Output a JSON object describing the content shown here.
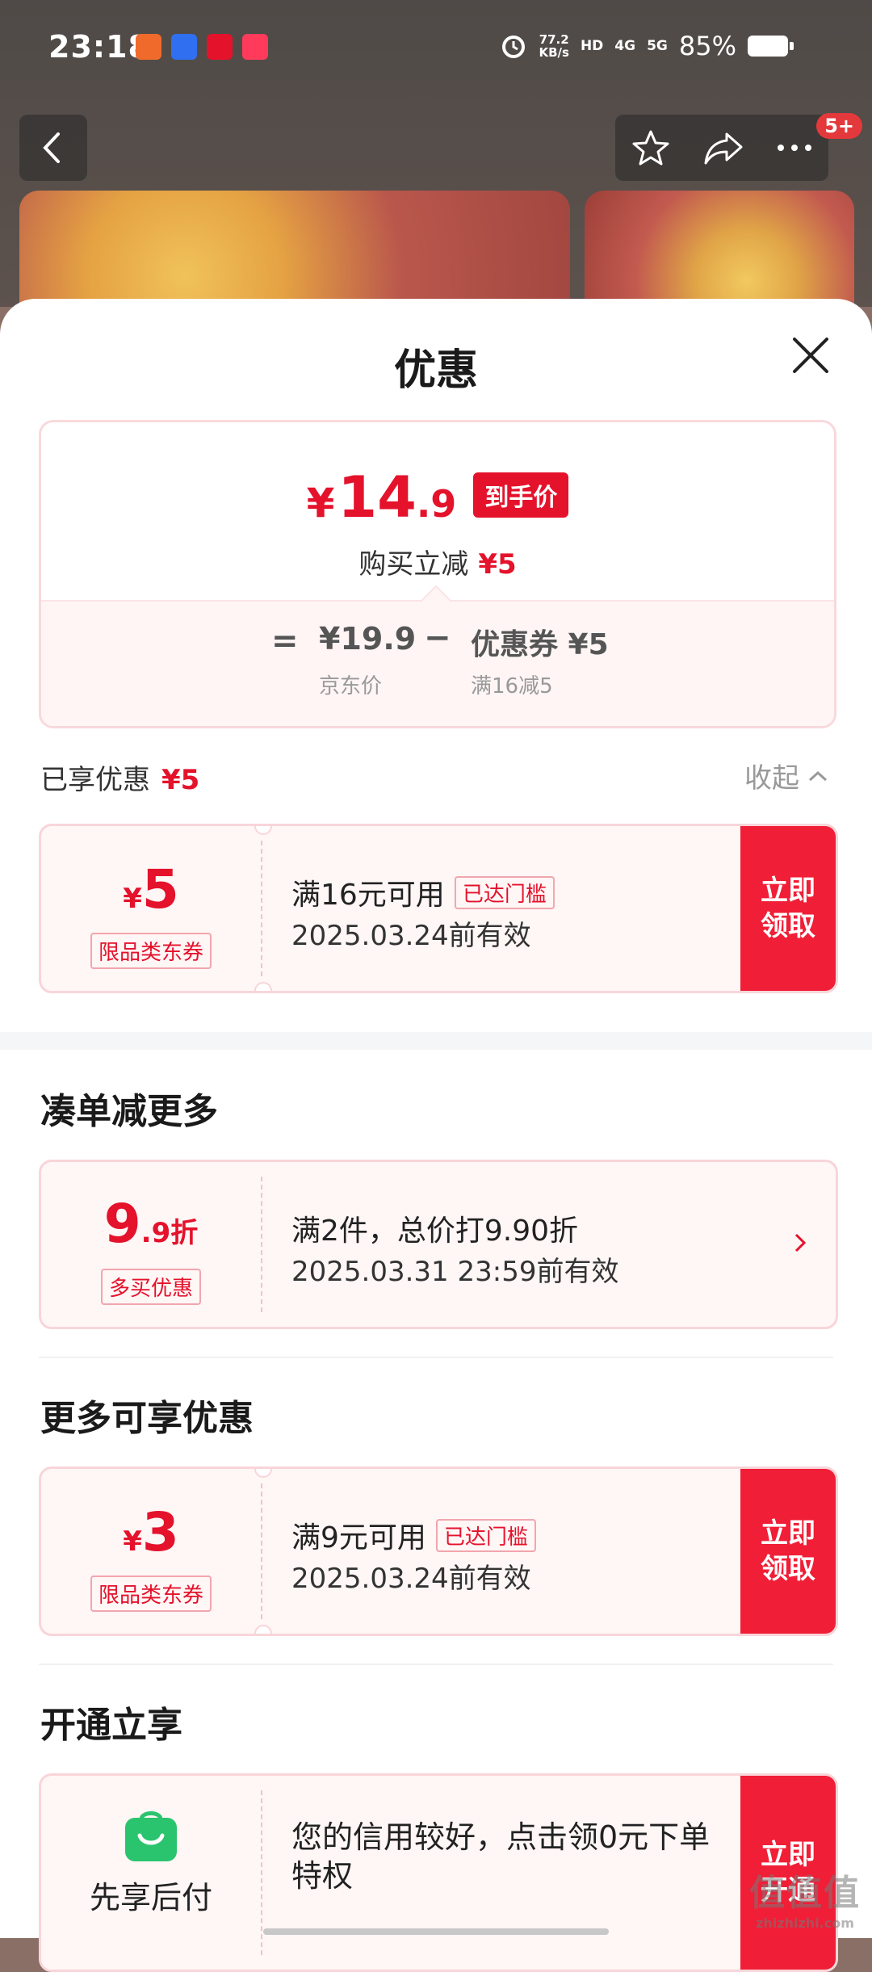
{
  "statusbar": {
    "time": "23:18",
    "net_speed_value": "77.2",
    "net_speed_unit": "KB/s",
    "hd": "HD",
    "sig1": "4G",
    "sig2": "5G",
    "battery": "85%"
  },
  "nav": {
    "badge": "5+"
  },
  "sheet": {
    "title": "优惠",
    "price": {
      "yen": "¥",
      "int": "14",
      "dec": ".9",
      "tag": "到手价"
    },
    "discount": {
      "label": "购买立减",
      "amount": "¥5"
    },
    "calc": {
      "eq": "=",
      "jd_price": "¥19.9",
      "jd_label": "京东价",
      "minus": "−",
      "coupon": "优惠券 ¥5",
      "coupon_rule": "满16减5"
    },
    "enjoyed": {
      "label": "已享优惠",
      "amount": "¥5",
      "collapse": "收起"
    }
  },
  "coupon1": {
    "sym": "¥",
    "amount": "5",
    "type": "限品类东券",
    "condition": "满16元可用",
    "tag": "已达门槛",
    "date": "2025.03.24前有效",
    "btn1": "立即",
    "btn2": "领取"
  },
  "section2": {
    "title": "凑单减更多"
  },
  "discount_card": {
    "num": "9",
    "dec": ".9",
    "zhe": "折",
    "type": "多买优惠",
    "condition": "满2件，总价打9.90折",
    "date": "2025.03.31 23:59前有效"
  },
  "section3": {
    "title": "更多可享优惠"
  },
  "coupon2": {
    "sym": "¥",
    "amount": "3",
    "type": "限品类东券",
    "condition": "满9元可用",
    "tag": "已达门槛",
    "date": "2025.03.24前有效",
    "btn1": "立即",
    "btn2": "领取"
  },
  "section4": {
    "title": "开通立享"
  },
  "paylater": {
    "label": "先享后付",
    "text": "您的信用较好，点击领0元下单特权",
    "btn1": "立即",
    "btn2": "开通"
  },
  "watermark": {
    "line1": "值值值",
    "line2": "zhizhizhi.com"
  },
  "colors": {
    "accent": "#e4122b",
    "button": "#f01e36",
    "paylater_green": "#2bc46e"
  }
}
